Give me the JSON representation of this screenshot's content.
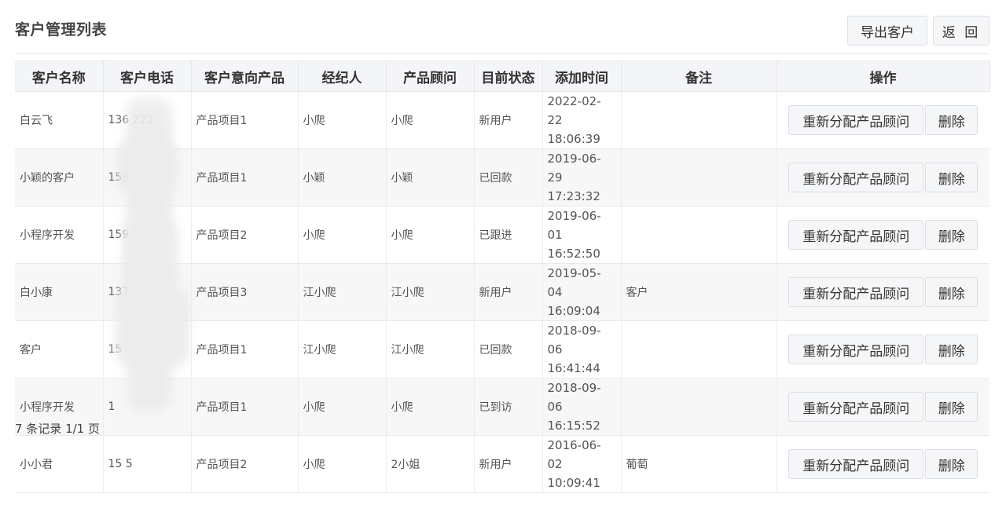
{
  "page": {
    "title": "客户管理列表",
    "export_label": "导出客户",
    "back_label": "返 回",
    "footer": "7 条记录 1/1 页"
  },
  "table": {
    "columns": [
      "客户名称",
      "客户电话",
      "客户意向产品",
      "经纪人",
      "产品顾问",
      "目前状态",
      "添加时间",
      "备注",
      "操作"
    ],
    "actions": {
      "reassign": "重新分配产品顾问",
      "delete": "删除"
    },
    "rows": [
      {
        "name": "白云飞",
        "phone": "136        222",
        "product": "产品项目1",
        "agent": "小爬",
        "consultant": "小爬",
        "status": "新用户",
        "date": "2022-02-22",
        "time": "18:06:39",
        "note": ""
      },
      {
        "name": "小颖的客户",
        "phone": "159          3",
        "product": "产品项目1",
        "agent": "小颖",
        "consultant": "小颖",
        "status": "已回款",
        "date": "2019-06-29",
        "time": "17:23:32",
        "note": ""
      },
      {
        "name": "小程序开发",
        "phone": "159          5",
        "product": "产品项目2",
        "agent": "小爬",
        "consultant": "小爬",
        "status": "已跟进",
        "date": "2019-06-01",
        "time": "16:52:50",
        "note": ""
      },
      {
        "name": "白小康",
        "phone": "1374         l",
        "product": "产品项目3",
        "agent": "江小爬",
        "consultant": "江小爬",
        "status": "新用户",
        "date": "2019-05-04",
        "time": "16:09:04",
        "note": "客户"
      },
      {
        "name": "客户",
        "phone": "15",
        "product": "产品项目1",
        "agent": "江小爬",
        "consultant": "江小爬",
        "status": "已回款",
        "date": "2018-09-06",
        "time": "16:41:44",
        "note": ""
      },
      {
        "name": "小程序开发",
        "phone": "1",
        "product": "产品项目1",
        "agent": "小爬",
        "consultant": "小爬",
        "status": "已到访",
        "date": "2018-09-06",
        "time": "16:15:52",
        "note": ""
      },
      {
        "name": "小小君",
        "phone": "15           5",
        "product": "产品项目2",
        "agent": "小爬",
        "consultant": "2小姐",
        "status": "新用户",
        "date": "2016-06-02",
        "time": "10:09:41",
        "note": "葡萄"
      }
    ]
  }
}
